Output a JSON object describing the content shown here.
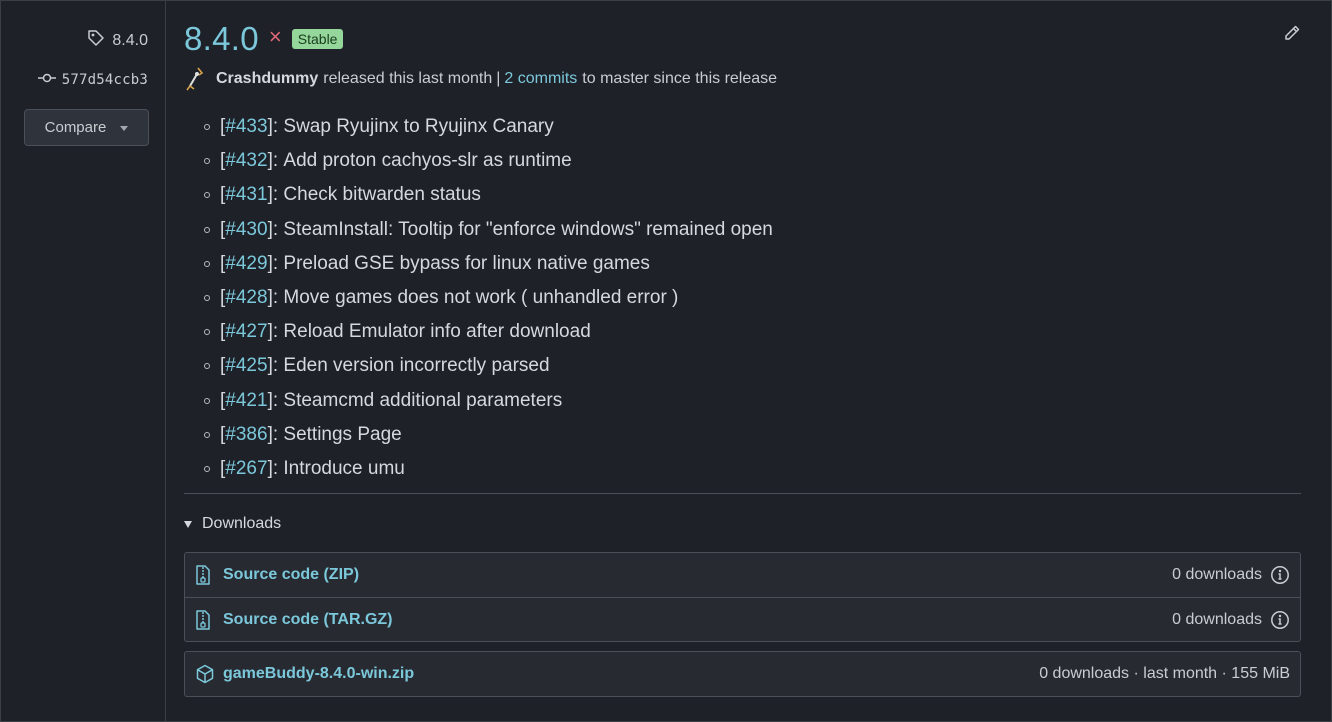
{
  "sidebar": {
    "tag": "8.4.0",
    "commit": "577d54ccb3",
    "compare_label": "Compare"
  },
  "release": {
    "version": "8.4.0",
    "close_glyph": "×",
    "badge": "Stable",
    "author": "Crashdummy",
    "released_text": "released this last month",
    "separator": "|",
    "commits_link": "2 commits",
    "commits_suffix": "to master since this release"
  },
  "changes": [
    {
      "num": "#433",
      "text": "Swap Ryujinx to Ryujinx Canary"
    },
    {
      "num": "#432",
      "text": "Add proton cachyos-slr as runtime"
    },
    {
      "num": "#431",
      "text": "Check bitwarden status"
    },
    {
      "num": "#430",
      "text": "SteamInstall: Tooltip for \"enforce windows\" remained open"
    },
    {
      "num": "#429",
      "text": "Preload GSE bypass for linux native games"
    },
    {
      "num": "#428",
      "text": "Move games does not work ( unhandled error )"
    },
    {
      "num": "#427",
      "text": "Reload Emulator info after download"
    },
    {
      "num": "#425",
      "text": "Eden version incorrectly parsed"
    },
    {
      "num": "#421",
      "text": "Steamcmd additional parameters"
    },
    {
      "num": "#386",
      "text": "Settings Page"
    },
    {
      "num": "#267",
      "text": "Introduce umu"
    }
  ],
  "downloads": {
    "label": "Downloads",
    "source_assets": [
      {
        "name": "Source code (ZIP)",
        "info": "0 downloads"
      },
      {
        "name": "Source code (TAR.GZ)",
        "info": "0 downloads"
      }
    ],
    "binary_asset": {
      "name": "gameBuddy-8.4.0-win.zip",
      "info": "0 downloads · last month · 155 MiB"
    }
  },
  "colors": {
    "accent": "#7cc8db",
    "badge_bg": "#95d69a",
    "close": "#e26a77",
    "background": "#1e2128"
  },
  "icons": [
    "tag-icon",
    "commit-icon",
    "caret-down-icon",
    "pencil-icon",
    "avatar",
    "archive-icon",
    "info-icon",
    "package-icon"
  ]
}
